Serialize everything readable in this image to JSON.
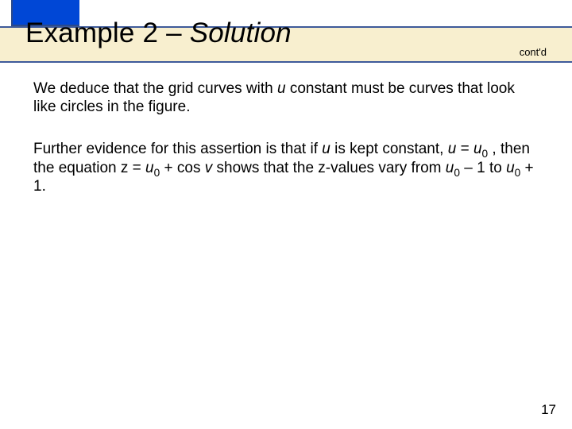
{
  "title": {
    "example_label": "Example 2 – ",
    "solution_label": "Solution",
    "contd": "cont'd"
  },
  "paragraphs": {
    "p1": {
      "t1": "We deduce that the grid curves with ",
      "u1": "u",
      "t2": " constant must be curves that look like circles in the figure."
    },
    "p2": {
      "t1": "Further evidence for this assertion is that if ",
      "u1": "u",
      "t2": " is kept constant, ",
      "u2": "u",
      "t3": " = ",
      "u3": "u",
      "sub1": "0",
      "t4": " , then the equation z = ",
      "u4": "u",
      "sub2": "0",
      "t5": " + cos ",
      "v1": "v",
      "t6": " shows that the z-values vary from ",
      "u5": "u",
      "sub3": "0",
      "t7": " – 1 to ",
      "u6": "u",
      "sub4": "0",
      "t8": " + 1."
    }
  },
  "page_number": "17"
}
